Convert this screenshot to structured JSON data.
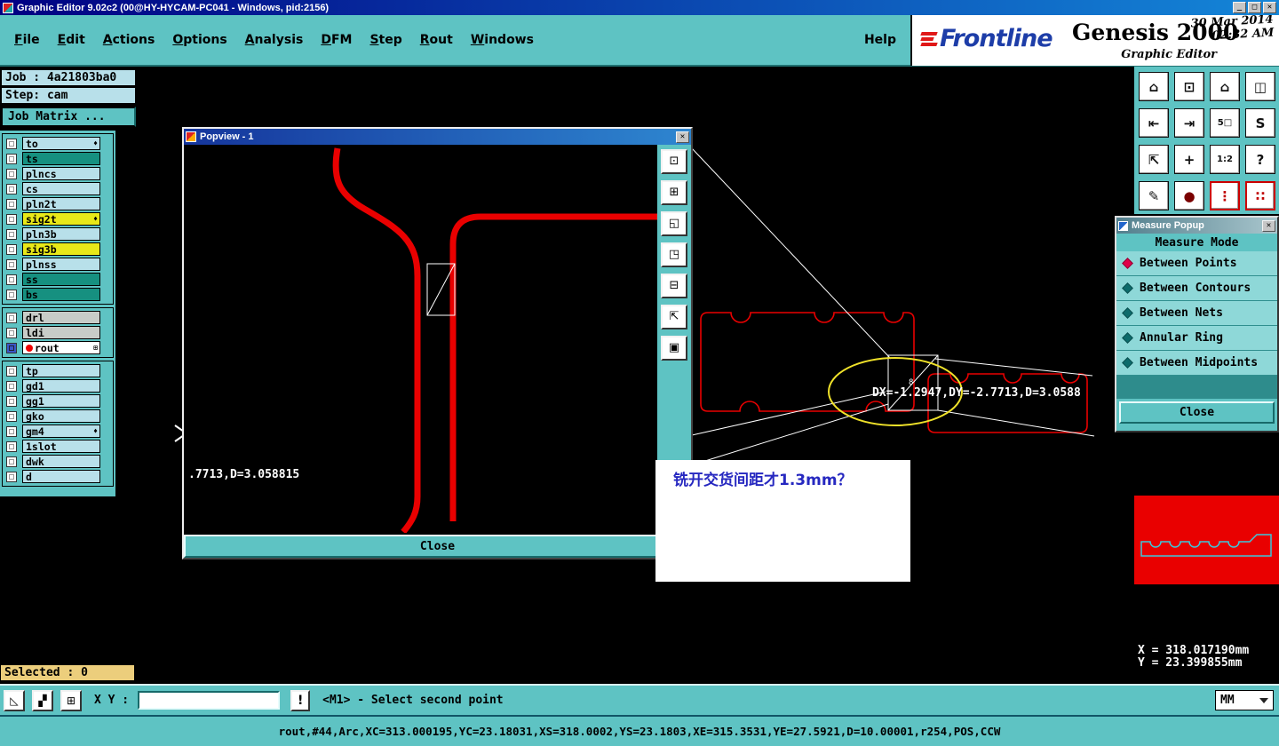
{
  "colors": {
    "teal": "#5ec3c3",
    "teal-dark": "#1e7878",
    "panel-cyan": "#b8e0ea",
    "layer-teal": "#169080",
    "layer-yellow": "#e8e819",
    "layer-gray": "#c8ccc8",
    "red": "#e90000",
    "highlight-yellow": "#f0e22a",
    "annotation-blue": "#2628c0",
    "selected-bg": "#ecce7c",
    "titlebar-left": "#000082",
    "titlebar-right": "#1486d8"
  },
  "icons": {
    "minimize": "_",
    "maximize": "□",
    "close": "✕"
  },
  "window": {
    "title": "Graphic Editor 9.02c2 (00@HY-HYCAM-PC041 - Windows, pid:2156)"
  },
  "menu": {
    "items": [
      "File",
      "Edit",
      "Actions",
      "Options",
      "Analysis",
      "DFM",
      "Step",
      "Rout",
      "Windows"
    ],
    "help": "Help"
  },
  "brand": {
    "frontline": "Frontline",
    "product": "Genesis 2000",
    "date": "30 Mar 2014",
    "time": "02:32 AM",
    "subtitle": "Graphic Editor"
  },
  "job_panel": {
    "job": "Job : 4a21803ba0",
    "step": "Step: cam",
    "matrix_button": "Job Matrix ..."
  },
  "layers": {
    "groups": [
      [
        {
          "name": "to",
          "color": "cyan",
          "marker": "♦"
        },
        {
          "name": "ts",
          "color": "teal"
        },
        {
          "name": "plncs",
          "color": "cyan"
        },
        {
          "name": "cs",
          "color": "cyan"
        },
        {
          "name": "pln2t",
          "color": "cyan"
        },
        {
          "name": "sig2t",
          "color": "yellow",
          "marker": "♦"
        },
        {
          "name": "pln3b",
          "color": "cyan"
        },
        {
          "name": "sig3b",
          "color": "yellow"
        },
        {
          "name": "plnss",
          "color": "cyan"
        },
        {
          "name": "ss",
          "color": "teal"
        },
        {
          "name": "bs",
          "color": "teal"
        }
      ],
      [
        {
          "name": "drl",
          "color": "gray"
        },
        {
          "name": "ldi",
          "color": "gray"
        },
        {
          "name": "rout",
          "color": "white",
          "special": true,
          "dot": true,
          "marker": "⊞"
        }
      ],
      [
        {
          "name": "tp",
          "color": "cyan"
        },
        {
          "name": "gd1",
          "color": "cyan"
        },
        {
          "name": "gg1",
          "color": "cyan"
        },
        {
          "name": "gko",
          "color": "cyan"
        },
        {
          "name": "gm4",
          "color": "cyan",
          "marker": "♦"
        },
        {
          "name": "1slot",
          "color": "cyan"
        },
        {
          "name": "dwk",
          "color": "cyan"
        },
        {
          "name": "d",
          "color": "cyan"
        }
      ]
    ]
  },
  "canvas": {
    "measure_readout": "DX=-1.2947,DY=-2.7713,D=3.0588",
    "zoom_label": "8",
    "annotation": "铣开交货间距才1.3mm？"
  },
  "popview": {
    "title": "Popview - 1",
    "close_label": "Close",
    "readout": ".7713,D=3.058815",
    "tools": [
      {
        "glyph": "⊡",
        "name": "popview-screen-icon"
      },
      {
        "glyph": "⊞",
        "name": "popview-grid-icon"
      },
      {
        "glyph": "◱",
        "name": "popview-corner-bl-icon"
      },
      {
        "glyph": "◳",
        "name": "popview-corner-tr-icon"
      },
      {
        "glyph": "⊟",
        "name": "popview-collapse-icon"
      },
      {
        "glyph": "⇱",
        "name": "popview-fit-icon"
      },
      {
        "glyph": "▣",
        "name": "popview-center-icon"
      }
    ]
  },
  "measure_popup": {
    "title": "Measure Popup",
    "header": "Measure Mode",
    "options": [
      "Between Points",
      "Between Contours",
      "Between Nets",
      "Annular Ring",
      "Between Midpoints"
    ],
    "selected_index": 0,
    "close_label": "Close"
  },
  "right_toolbar": {
    "icons": [
      {
        "glyph": "⌂",
        "name": "home-view-icon"
      },
      {
        "glyph": "⊡",
        "name": "screen-view-icon"
      },
      {
        "glyph": "⌂",
        "name": "home-alt-icon"
      },
      {
        "glyph": "◫",
        "name": "tile-windows-icon"
      },
      {
        "glyph": "⇤",
        "name": "pan-left-icon"
      },
      {
        "glyph": "⇥",
        "name": "pan-right-icon"
      },
      {
        "glyph": "5□",
        "name": "five-window-icon"
      },
      {
        "glyph": "S",
        "name": "s-view-icon"
      },
      {
        "glyph": "⇱",
        "name": "zoom-corner-icon"
      },
      {
        "glyph": "+",
        "name": "crosshair-icon"
      },
      {
        "glyph": "1:2",
        "name": "zoom-ratio-icon"
      },
      {
        "glyph": "?",
        "name": "help-icon"
      },
      {
        "glyph": "✎",
        "name": "edit-icon"
      },
      {
        "glyph": "●",
        "name": "ball-icon",
        "color": "#7a0000"
      },
      {
        "glyph": "⋮",
        "name": "traffic-light-icon",
        "active": true,
        "color": "#c00000"
      },
      {
        "glyph": "∷",
        "name": "traffic-lights-icon",
        "active": true,
        "color": "#c00000"
      }
    ]
  },
  "coordinates": {
    "x": "X = 318.017190mm",
    "y": "Y = 23.399855mm"
  },
  "status_bar": {
    "selected": "Selected : 0",
    "xy_label": "X Y :",
    "input_value": "",
    "alert_label": "!",
    "message": "<M1> - Select second point",
    "units": "MM",
    "tools": [
      {
        "glyph": "◺",
        "name": "select-tool-icon"
      },
      {
        "glyph": "▞",
        "name": "hatch-tool-icon"
      },
      {
        "glyph": "⊞",
        "name": "grid-tool-icon"
      }
    ]
  },
  "command_bar": {
    "text": "rout,#44,Arc,XC=313.000195,YC=23.18031,XS=318.0002,YS=23.1803,XE=315.3531,YE=27.5921,D=10.00001,r254,POS,CCW"
  }
}
